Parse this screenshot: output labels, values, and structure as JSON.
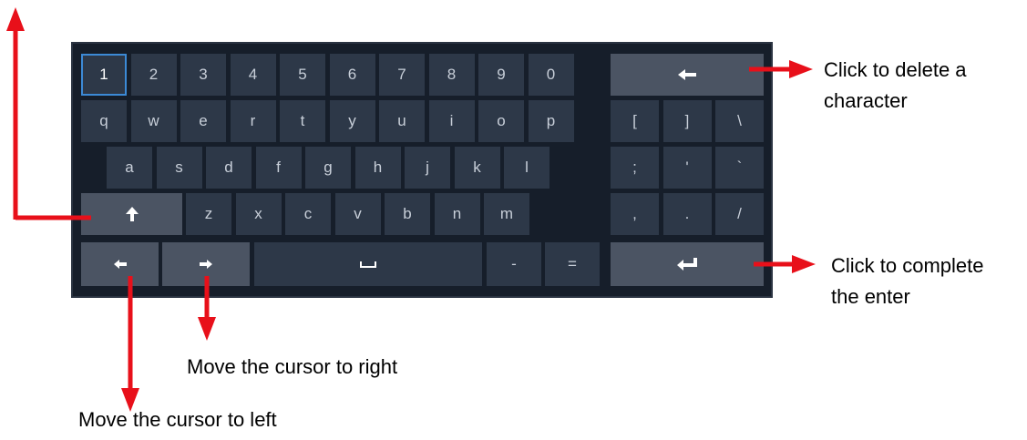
{
  "keyboard": {
    "row1": [
      "1",
      "2",
      "3",
      "4",
      "5",
      "6",
      "7",
      "8",
      "9",
      "0"
    ],
    "row2": [
      "q",
      "w",
      "e",
      "r",
      "t",
      "y",
      "u",
      "i",
      "o",
      "p"
    ],
    "row3": [
      "a",
      "s",
      "d",
      "f",
      "g",
      "h",
      "j",
      "k",
      "l"
    ],
    "row4": [
      "z",
      "x",
      "c",
      "v",
      "b",
      "n",
      "m"
    ],
    "symbols": [
      "[",
      "]",
      "\\",
      ";",
      "'",
      "`",
      ",",
      ".",
      "/"
    ],
    "dash": "-",
    "equals": "=",
    "icons": {
      "backspace": "arrow-left-icon",
      "shift": "arrow-up-icon",
      "cursor_left": "arrow-left-icon",
      "cursor_right": "arrow-right-icon",
      "space": "space-bar-icon",
      "enter": "enter-return-icon"
    },
    "focused_key": "1"
  },
  "annotations": {
    "delete": [
      "Click to delete a",
      "character"
    ],
    "enter": [
      "Click to complete",
      "the enter"
    ],
    "right": "Move the cursor to right",
    "left": "Move the cursor to left"
  },
  "colors": {
    "arrow": "#e8101a",
    "key": "#2d3848",
    "special_key": "#4b5463",
    "panel": "#161e2a",
    "focus": "#3c8ad6"
  }
}
